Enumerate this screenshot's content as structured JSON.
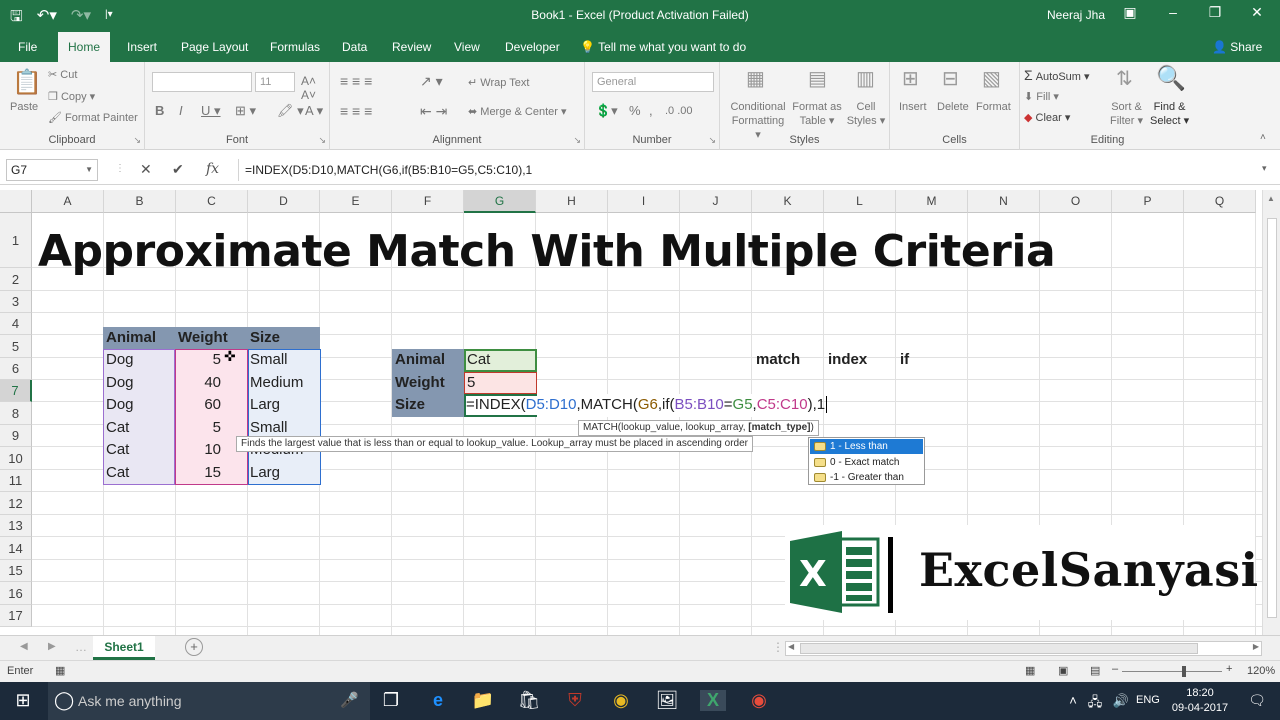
{
  "titlebar": {
    "title": "Book1  -  Excel (Product Activation Failed)",
    "user": "Neeraj Jha",
    "qat_icons": [
      "save-icon",
      "undo-icon",
      "redo-icon",
      "customize-icon"
    ]
  },
  "tabs": [
    {
      "label": "File",
      "active": false
    },
    {
      "label": "Home",
      "active": true
    },
    {
      "label": "Insert",
      "active": false
    },
    {
      "label": "Page Layout",
      "active": false
    },
    {
      "label": "Formulas",
      "active": false
    },
    {
      "label": "Data",
      "active": false
    },
    {
      "label": "Review",
      "active": false
    },
    {
      "label": "View",
      "active": false
    },
    {
      "label": "Developer",
      "active": false
    }
  ],
  "tell_me": "Tell me what you want to do",
  "share": "Share",
  "ribbon": {
    "clipboard": {
      "label": "Clipboard",
      "paste": "Paste",
      "cut": "Cut",
      "copy": "Copy",
      "format_painter": "Format Painter"
    },
    "font": {
      "label": "Font",
      "font_name": "",
      "font_size": "11"
    },
    "alignment": {
      "label": "Alignment",
      "wrap": "Wrap Text",
      "merge": "Merge & Center"
    },
    "number": {
      "label": "Number",
      "format": "General"
    },
    "styles": {
      "label": "Styles",
      "cond": "Conditional",
      "cond2": "Formatting",
      "fmt_table": "Format as",
      "fmt_table2": "Table",
      "cell_styles": "Cell",
      "cell_styles2": "Styles"
    },
    "cells": {
      "label": "Cells",
      "insert": "Insert",
      "delete": "Delete",
      "format": "Format"
    },
    "editing": {
      "label": "Editing",
      "autosum": "AutoSum",
      "fill": "Fill",
      "clear": "Clear",
      "sort": "Sort &",
      "sort2": "Filter",
      "find": "Find &",
      "find2": "Select"
    }
  },
  "formula_bar": {
    "name_box": "G7",
    "formula": "=INDEX(D5:D10,MATCH(G6,if(B5:B10=G5,C5:C10),1"
  },
  "grid": {
    "columns": [
      "A",
      "B",
      "C",
      "D",
      "E",
      "F",
      "G",
      "H",
      "I",
      "J",
      "K",
      "L",
      "M",
      "N",
      "O",
      "P",
      "Q"
    ],
    "rows": [
      "1",
      "2",
      "3",
      "4",
      "5",
      "6",
      "7",
      "8",
      "9",
      "10",
      "11",
      "12",
      "13",
      "14",
      "15",
      "16",
      "17"
    ],
    "selected_col": "G",
    "selected_row": "7",
    "title": "Approximate Match With Multiple Criteria",
    "table_headers": [
      "Animal",
      "Weight",
      "Size"
    ],
    "table_rows": [
      [
        "Dog",
        "5",
        "Small"
      ],
      [
        "Dog",
        "40",
        "Medium"
      ],
      [
        "Dog",
        "60",
        "Larg"
      ],
      [
        "Cat",
        "5",
        "Small"
      ],
      [
        "Cat",
        "10",
        "Medium"
      ],
      [
        "Cat",
        "15",
        "Larg"
      ]
    ],
    "lookup_labels": [
      "Animal",
      "Weight",
      "Size"
    ],
    "lookup_values": [
      "Cat",
      "5"
    ],
    "edit_formula": {
      "p1": "=INDEX(",
      "p2": "D5:D10",
      "p3": ",MATCH(",
      "p4": "G6",
      "p5": ",if(",
      "p6": "B5:B10",
      "p7": "=",
      "p8": "G5",
      "p9": ",",
      "p10": "C5:C10",
      "p11": "),1"
    },
    "notes": [
      "match",
      "index",
      "if"
    ]
  },
  "tooltips": {
    "syntax_prefix": "MATCH(lookup_value, lookup_array, ",
    "syntax_bold": "[match_type]",
    "syntax_suffix": ")",
    "description": "Finds the largest value that is less than or equal to lookup_value. Lookup_array must be placed in ascending order",
    "options": [
      "1 - Less than",
      "0 - Exact match",
      "-1 - Greater than"
    ]
  },
  "sheet_tab": "Sheet1",
  "status": {
    "mode": "Enter",
    "zoom": "120%"
  },
  "logo_text": "ExcelSanyasi",
  "taskbar": {
    "search_placeholder": "Ask me anything",
    "language": "ENG",
    "time": "18:20",
    "date": "09-04-2017"
  },
  "colors": {
    "excel_green": "#217346",
    "selection_blue": "#1e7ad4"
  }
}
